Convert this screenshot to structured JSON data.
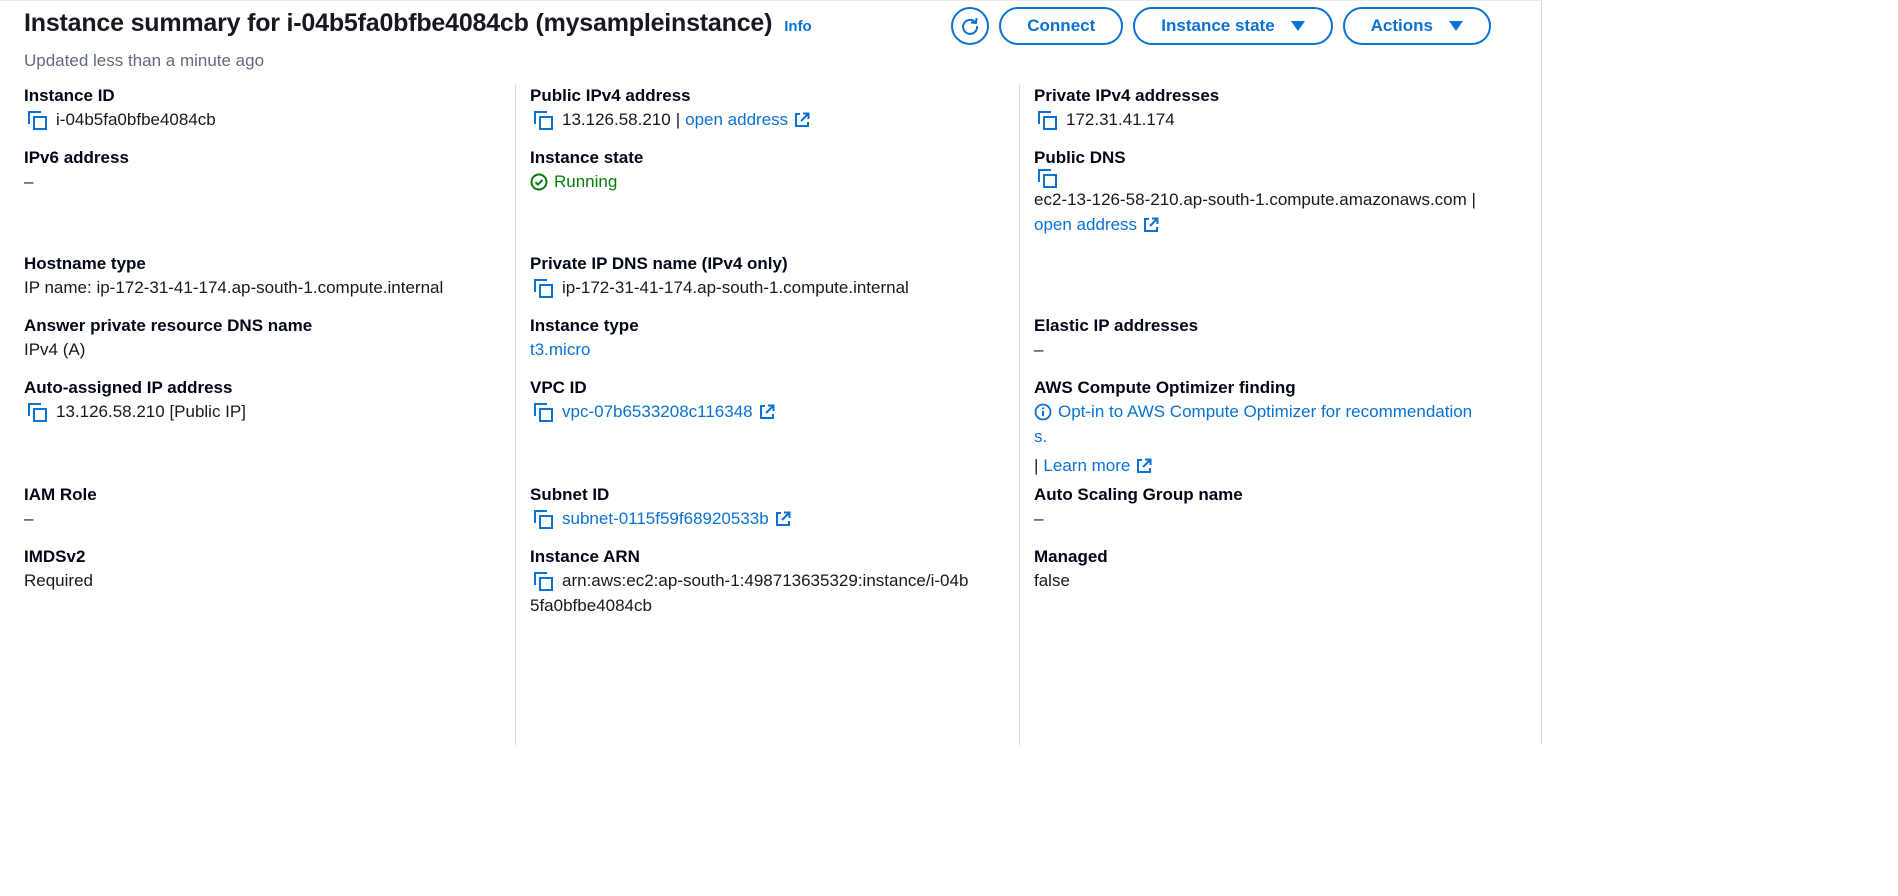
{
  "header": {
    "title": "Instance summary for i-04b5fa0bfbe4084cb (mysampleinstance)",
    "info": "Info",
    "updated": "Updated less than a minute ago"
  },
  "actions": {
    "connect": "Connect",
    "instance_state": "Instance state",
    "actions": "Actions"
  },
  "col1": {
    "instance_id_label": "Instance ID",
    "instance_id": "i-04b5fa0bfbe4084cb",
    "ipv6_label": "IPv6 address",
    "ipv6": "–",
    "hostname_type_label": "Hostname type",
    "hostname_type": "IP name: ip-172-31-41-174.ap-south-1.compute.internal",
    "answer_dns_label": "Answer private resource DNS name",
    "answer_dns": "IPv4 (A)",
    "auto_ip_label": "Auto-assigned IP address",
    "auto_ip": "13.126.58.210 [Public IP]",
    "iam_role_label": "IAM Role",
    "iam_role": "–",
    "imdsv2_label": "IMDSv2",
    "imdsv2": "Required"
  },
  "col2": {
    "public_ipv4_label": "Public IPv4 address",
    "public_ipv4": "13.126.58.210",
    "separator": "|",
    "open_address": "open address",
    "instance_state_label": "Instance state",
    "instance_state": "Running",
    "private_dns_label": "Private IP DNS name (IPv4 only)",
    "private_dns": "ip-172-31-41-174.ap-south-1.compute.internal",
    "instance_type_label": "Instance type",
    "instance_type": "t3.micro",
    "vpc_id_label": "VPC ID",
    "vpc_id": "vpc-07b6533208c116348",
    "subnet_id_label": "Subnet ID",
    "subnet_id": "subnet-0115f59f68920533b",
    "arn_label": "Instance ARN",
    "arn_line1": "arn:aws:ec2:ap-south-1:498713635329:instance/i-04b",
    "arn_line2": "5fa0bfbe4084cb"
  },
  "col3": {
    "private_ipv4_label": "Private IPv4 addresses",
    "private_ipv4": "172.31.41.174",
    "public_dns_label": "Public DNS",
    "public_dns": "ec2-13-126-58-210.ap-south-1.compute.amazonaws.com |",
    "open_address": "open address",
    "elastic_ip_label": "Elastic IP addresses",
    "elastic_ip": "–",
    "optimizer_label": "AWS Compute Optimizer finding",
    "optimizer_line1": "Opt-in to AWS Compute Optimizer for recommendation",
    "optimizer_line2": "s.",
    "learn_sep": "|",
    "learn_more": "Learn more",
    "asg_label": "Auto Scaling Group name",
    "asg": "–",
    "managed_label": "Managed",
    "managed": "false"
  },
  "colors": {
    "link": "#0972d3",
    "success": "#037f0c",
    "text": "#16191f",
    "border": "#d5dbdb"
  }
}
